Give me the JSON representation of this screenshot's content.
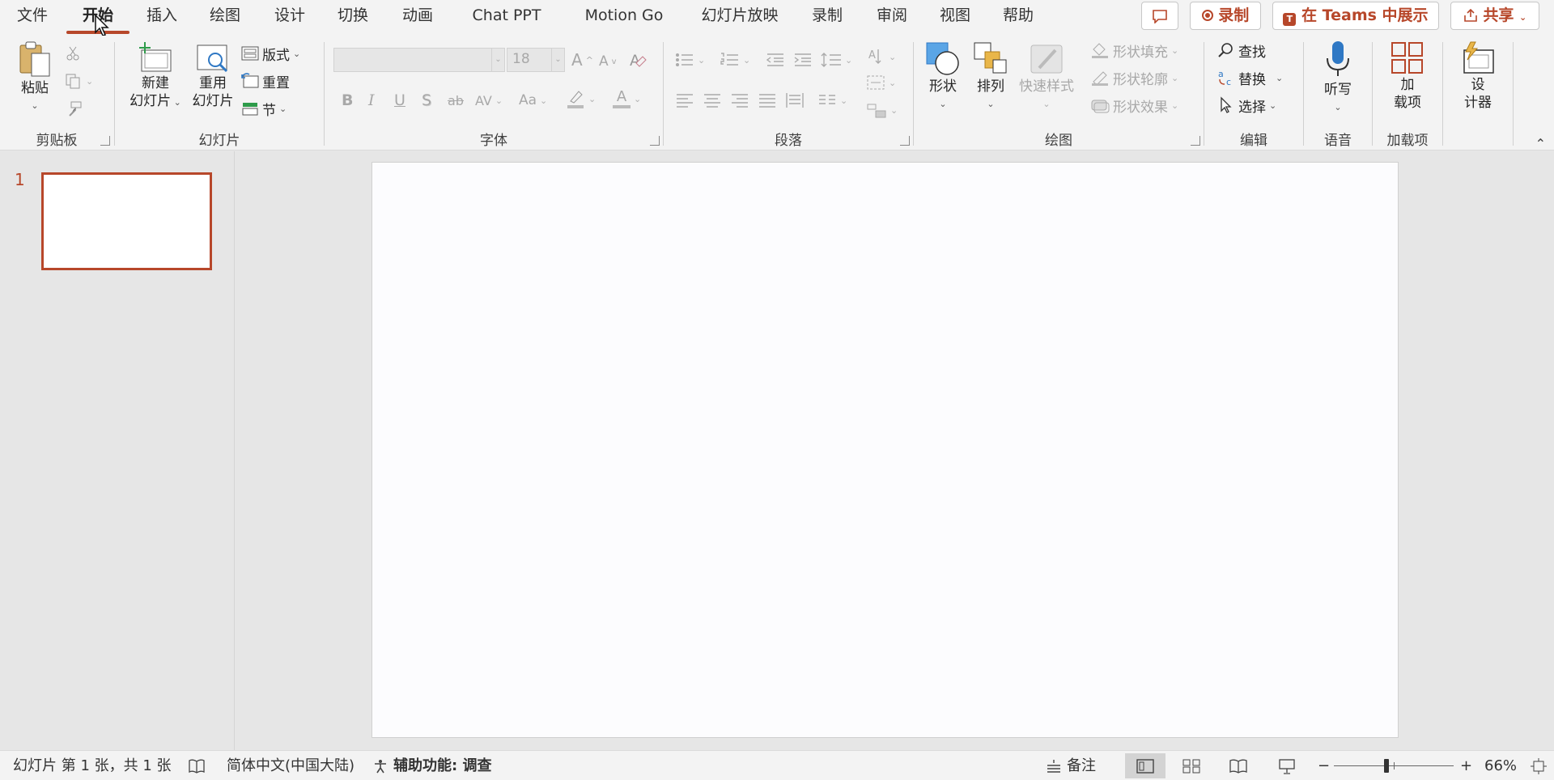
{
  "tabs": [
    {
      "label": "文件"
    },
    {
      "label": "开始"
    },
    {
      "label": "插入"
    },
    {
      "label": "绘图"
    },
    {
      "label": "设计"
    },
    {
      "label": "切换"
    },
    {
      "label": "动画"
    },
    {
      "label": "Chat PPT"
    },
    {
      "label": "Motion Go"
    },
    {
      "label": "幻灯片放映"
    },
    {
      "label": "录制"
    },
    {
      "label": "审阅"
    },
    {
      "label": "视图"
    },
    {
      "label": "帮助"
    }
  ],
  "active_tab": "开始",
  "right_buttons": {
    "record": "录制",
    "teams": "在 Teams 中展示",
    "share": "共享"
  },
  "ribbon": {
    "clipboard": {
      "label": "剪贴板",
      "paste": "粘贴"
    },
    "slides": {
      "label": "幻灯片",
      "new_slide_1": "新建",
      "new_slide_2": "幻灯片",
      "reuse_1": "重用",
      "reuse_2": "幻灯片",
      "layout": "版式",
      "reset": "重置",
      "section": "节"
    },
    "font": {
      "label": "字体",
      "font_name": "",
      "font_size": "18",
      "bold": "B",
      "italic": "I",
      "underline": "U",
      "shadow": "S",
      "strike": "ab",
      "spacing": "AV",
      "case": "Aa",
      "grow": "A",
      "shrink": "A",
      "font_color": "A"
    },
    "paragraph": {
      "label": "段落"
    },
    "drawing": {
      "label": "绘图",
      "shapes": "形状",
      "arrange": "排列",
      "quick_styles": "快速样式",
      "fill": "形状填充",
      "outline": "形状轮廓",
      "effects": "形状效果"
    },
    "editing": {
      "label": "编辑",
      "find": "查找",
      "replace": "替换",
      "select": "选择"
    },
    "voice": {
      "label": "语音",
      "dictate": "听写"
    },
    "addins": {
      "label": "加载项",
      "addins_1": "加",
      "addins_2": "载项"
    },
    "designer": {
      "designer_1": "设",
      "designer_2": "计器"
    }
  },
  "thumbnails": [
    {
      "number": "1"
    }
  ],
  "status": {
    "slide_info": "幻灯片 第 1 张，共 1 张",
    "language": "简体中文(中国大陆)",
    "accessibility": "辅助功能: 调查",
    "notes": "备注",
    "zoom": "66%",
    "zoom_minus": "−",
    "zoom_plus": "+",
    "zoom_level": 0.44
  },
  "colors": {
    "accent": "#b7472a",
    "ribbon_bg": "#f3f3f3",
    "workspace": "#e6e6e6"
  }
}
